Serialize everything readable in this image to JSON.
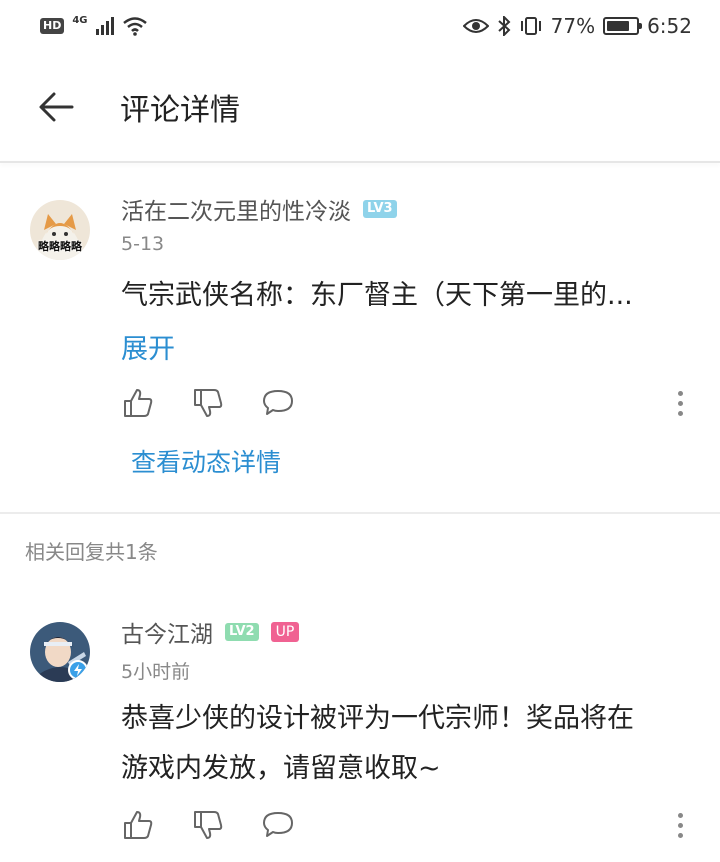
{
  "status_bar": {
    "hd": "HD",
    "network": "4G",
    "battery_text": "77%",
    "battery_level": 0.77,
    "time": "6:52"
  },
  "header": {
    "title": "评论详情"
  },
  "main_comment": {
    "username": "活在二次元里的性冷淡",
    "level": "LV3",
    "level_color": "#5bc0de",
    "date": "5-13",
    "text": "气宗武侠名称：东厂督主（天下第一里的...",
    "expand_label": "展开",
    "view_detail_label": "查看动态详情",
    "avatar_caption": "略略略略"
  },
  "replies_header": "相关回复共1条",
  "reply": {
    "username": "古今江湖",
    "level": "LV2",
    "level_color": "#6fcf97",
    "up_badge": "UP",
    "date": "5小时前",
    "text_line1": "恭喜少侠的设计被评为一代宗师！奖品将在",
    "text_line2": "游戏内发放，请留意收取~"
  }
}
